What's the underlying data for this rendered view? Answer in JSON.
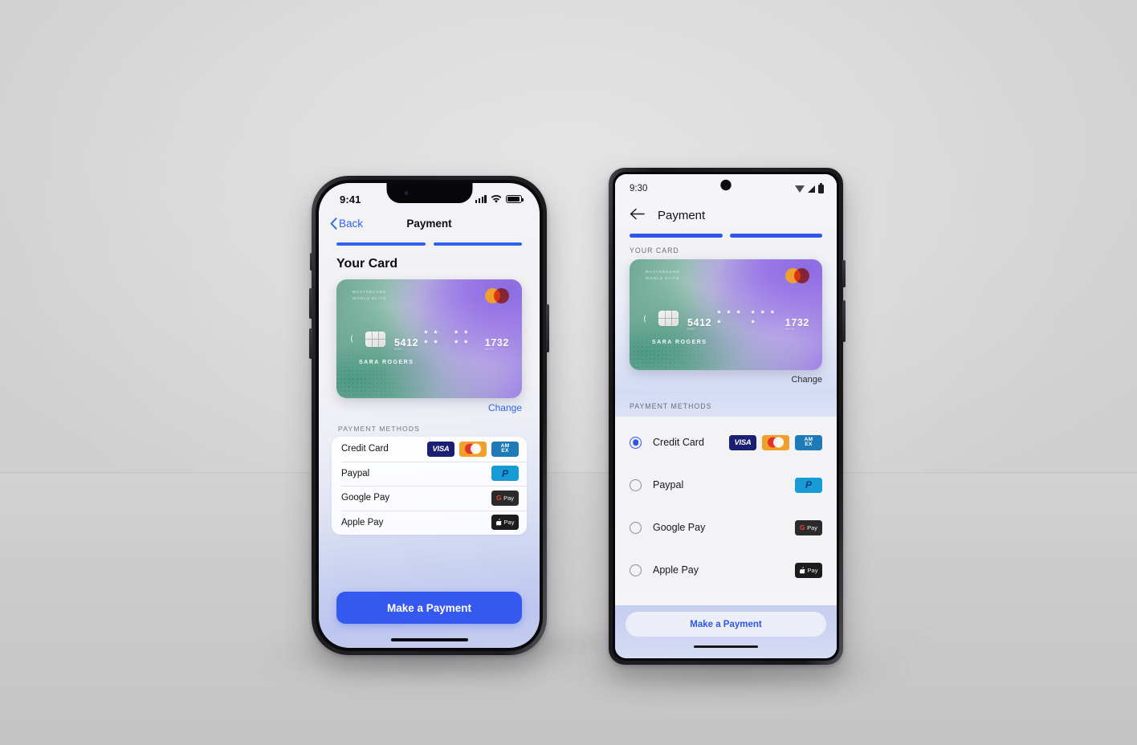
{
  "scene": {
    "background_color": "#d6d6d6"
  },
  "iphone": {
    "status": {
      "time": "9:41",
      "icons": [
        "signal-bars",
        "wifi",
        "battery"
      ]
    },
    "nav": {
      "back_label": "Back",
      "title": "Payment"
    },
    "steps": [
      {
        "filled": true
      },
      {
        "filled": true
      }
    ],
    "section_title": "Your Card",
    "card": {
      "brand_line1": "MASTERCARD",
      "brand_line2": "WORLD ELITE",
      "number_first": "5412",
      "number_mask_1": "* * * *",
      "number_mask_2": "* * * *",
      "number_last": "1732",
      "label_under_first": "0000",
      "label_under_last": "06/25",
      "holder": "SARA  ROGERS",
      "network": "mastercard"
    },
    "change_label": "Change",
    "payment_methods_label": "PAYMENT METHODS",
    "methods": [
      {
        "label": "Credit Card",
        "logos": [
          "visa",
          "mastercard",
          "amex"
        ]
      },
      {
        "label": "Paypal",
        "logos": [
          "paypal"
        ]
      },
      {
        "label": "Google Pay",
        "logos": [
          "gpay"
        ]
      },
      {
        "label": "Apple Pay",
        "logos": [
          "applepay"
        ]
      }
    ],
    "cta_label": "Make a Payment"
  },
  "android": {
    "status": {
      "time": "9:30",
      "icons": [
        "wifi",
        "signal",
        "battery"
      ]
    },
    "appbar": {
      "title": "Payment",
      "back_icon": "arrow-left"
    },
    "steps": [
      {
        "filled": true
      },
      {
        "filled": true
      }
    ],
    "your_card_label": "YOUR CARD",
    "card": {
      "brand_line1": "MASTERCARD",
      "brand_line2": "WORLD ELITE",
      "number_first": "5412",
      "number_mask_1": "* * * *",
      "number_mask_2": "* * * *",
      "number_last": "1732",
      "label_under_first": "0000",
      "label_under_last": "06/25",
      "holder": "SARA  ROGERS"
    },
    "change_label": "Change",
    "payment_methods_label": "PAYMENT METHODS",
    "methods": [
      {
        "label": "Credit Card",
        "selected": true,
        "logos": [
          "visa",
          "mastercard",
          "amex"
        ]
      },
      {
        "label": "Paypal",
        "selected": false,
        "logos": [
          "paypal"
        ]
      },
      {
        "label": "Google Pay",
        "selected": false,
        "logos": [
          "gpay"
        ]
      },
      {
        "label": "Apple Pay",
        "selected": false,
        "logos": [
          "applepay"
        ]
      }
    ],
    "cta_label": "Make a Payment"
  },
  "logos": {
    "visa_text": "VISA",
    "amex_line1": "AM",
    "amex_line2": "EX",
    "paypal_text": "P",
    "gpay_g": "G",
    "gpay_text": "Pay",
    "applepay_apple": "●",
    "applepay_text": "Pay"
  },
  "colors": {
    "ios_blue": "#2c63f0",
    "cta_blue": "#3558ef",
    "android_blue": "#2f56e8"
  }
}
